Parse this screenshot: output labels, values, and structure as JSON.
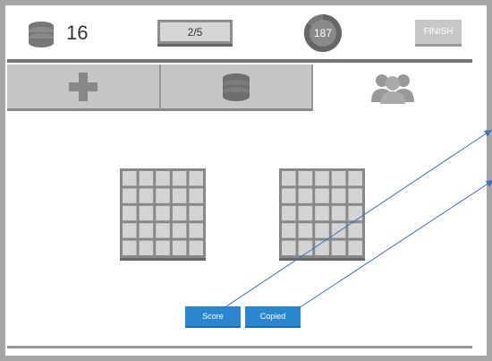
{
  "header": {
    "coin_count": "16",
    "progress": "2/5",
    "timer": "187",
    "finish_label": "FINISH"
  },
  "tabs": [
    {
      "name": "add",
      "icon": "plus-icon",
      "active": false
    },
    {
      "name": "database",
      "icon": "database-icon",
      "active": false
    },
    {
      "name": "players",
      "icon": "group-icon",
      "active": true
    }
  ],
  "grids": [
    {
      "rows": 5,
      "cols": 5
    },
    {
      "rows": 5,
      "cols": 5
    }
  ],
  "buttons": {
    "score_label": "Score",
    "copied_label": "Copied"
  },
  "colors": {
    "accent": "#2b86d2",
    "frame": "#a6a6a6",
    "tile": "#d4d4d4",
    "arrow": "#3a6fc4"
  }
}
